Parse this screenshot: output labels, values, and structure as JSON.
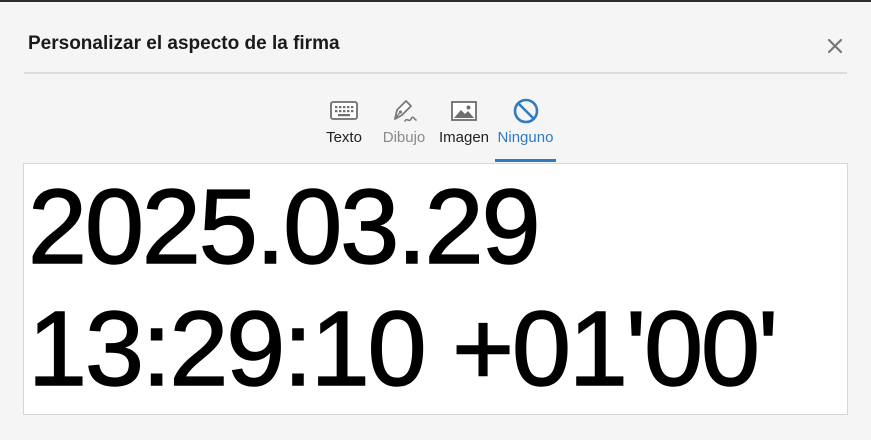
{
  "dialog": {
    "title": "Personalizar el aspecto de la firma",
    "close_icon": "close-icon"
  },
  "tabs": [
    {
      "label": "Texto",
      "icon": "keyboard-icon",
      "state": "normal"
    },
    {
      "label": "Dibujo",
      "icon": "pen-icon",
      "state": "disabled"
    },
    {
      "label": "Imagen",
      "icon": "image-icon",
      "state": "normal"
    },
    {
      "label": "Ninguno",
      "icon": "none-icon",
      "state": "active"
    }
  ],
  "preview": {
    "line1": "2025.03.29",
    "line2": "13:29:10 +01'00'"
  },
  "colors": {
    "accent": "#2f7bc0",
    "background": "#f5f5f5",
    "disabled_text": "#8a8a8a"
  }
}
